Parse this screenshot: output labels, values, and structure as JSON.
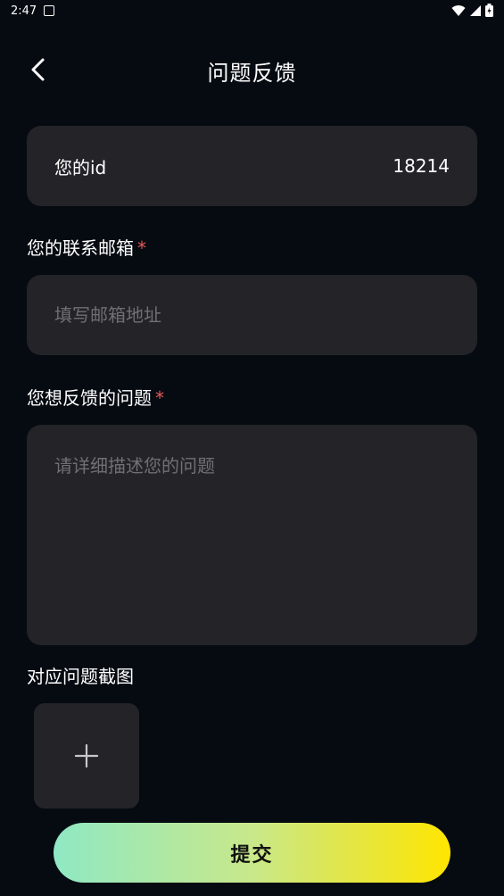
{
  "status_bar": {
    "time": "2:47"
  },
  "header": {
    "title": "问题反馈"
  },
  "id_row": {
    "label": "您的id",
    "value": "18214"
  },
  "email": {
    "label": "您的联系邮箱",
    "required_mark": "*",
    "placeholder": "填写邮箱地址",
    "value": ""
  },
  "description": {
    "label": "您想反馈的问题",
    "required_mark": "*",
    "placeholder": "请详细描述您的问题",
    "value": ""
  },
  "screenshot": {
    "label": "对应问题截图"
  },
  "submit": {
    "label": "提交"
  },
  "colors": {
    "background": "#060b12",
    "card": "#232328",
    "required": "#e85a5a",
    "button_gradient_start": "#8fe8c4",
    "button_gradient_end": "#ffe500"
  },
  "icons": {
    "back": "chevron-left-icon",
    "add": "plus-icon"
  }
}
